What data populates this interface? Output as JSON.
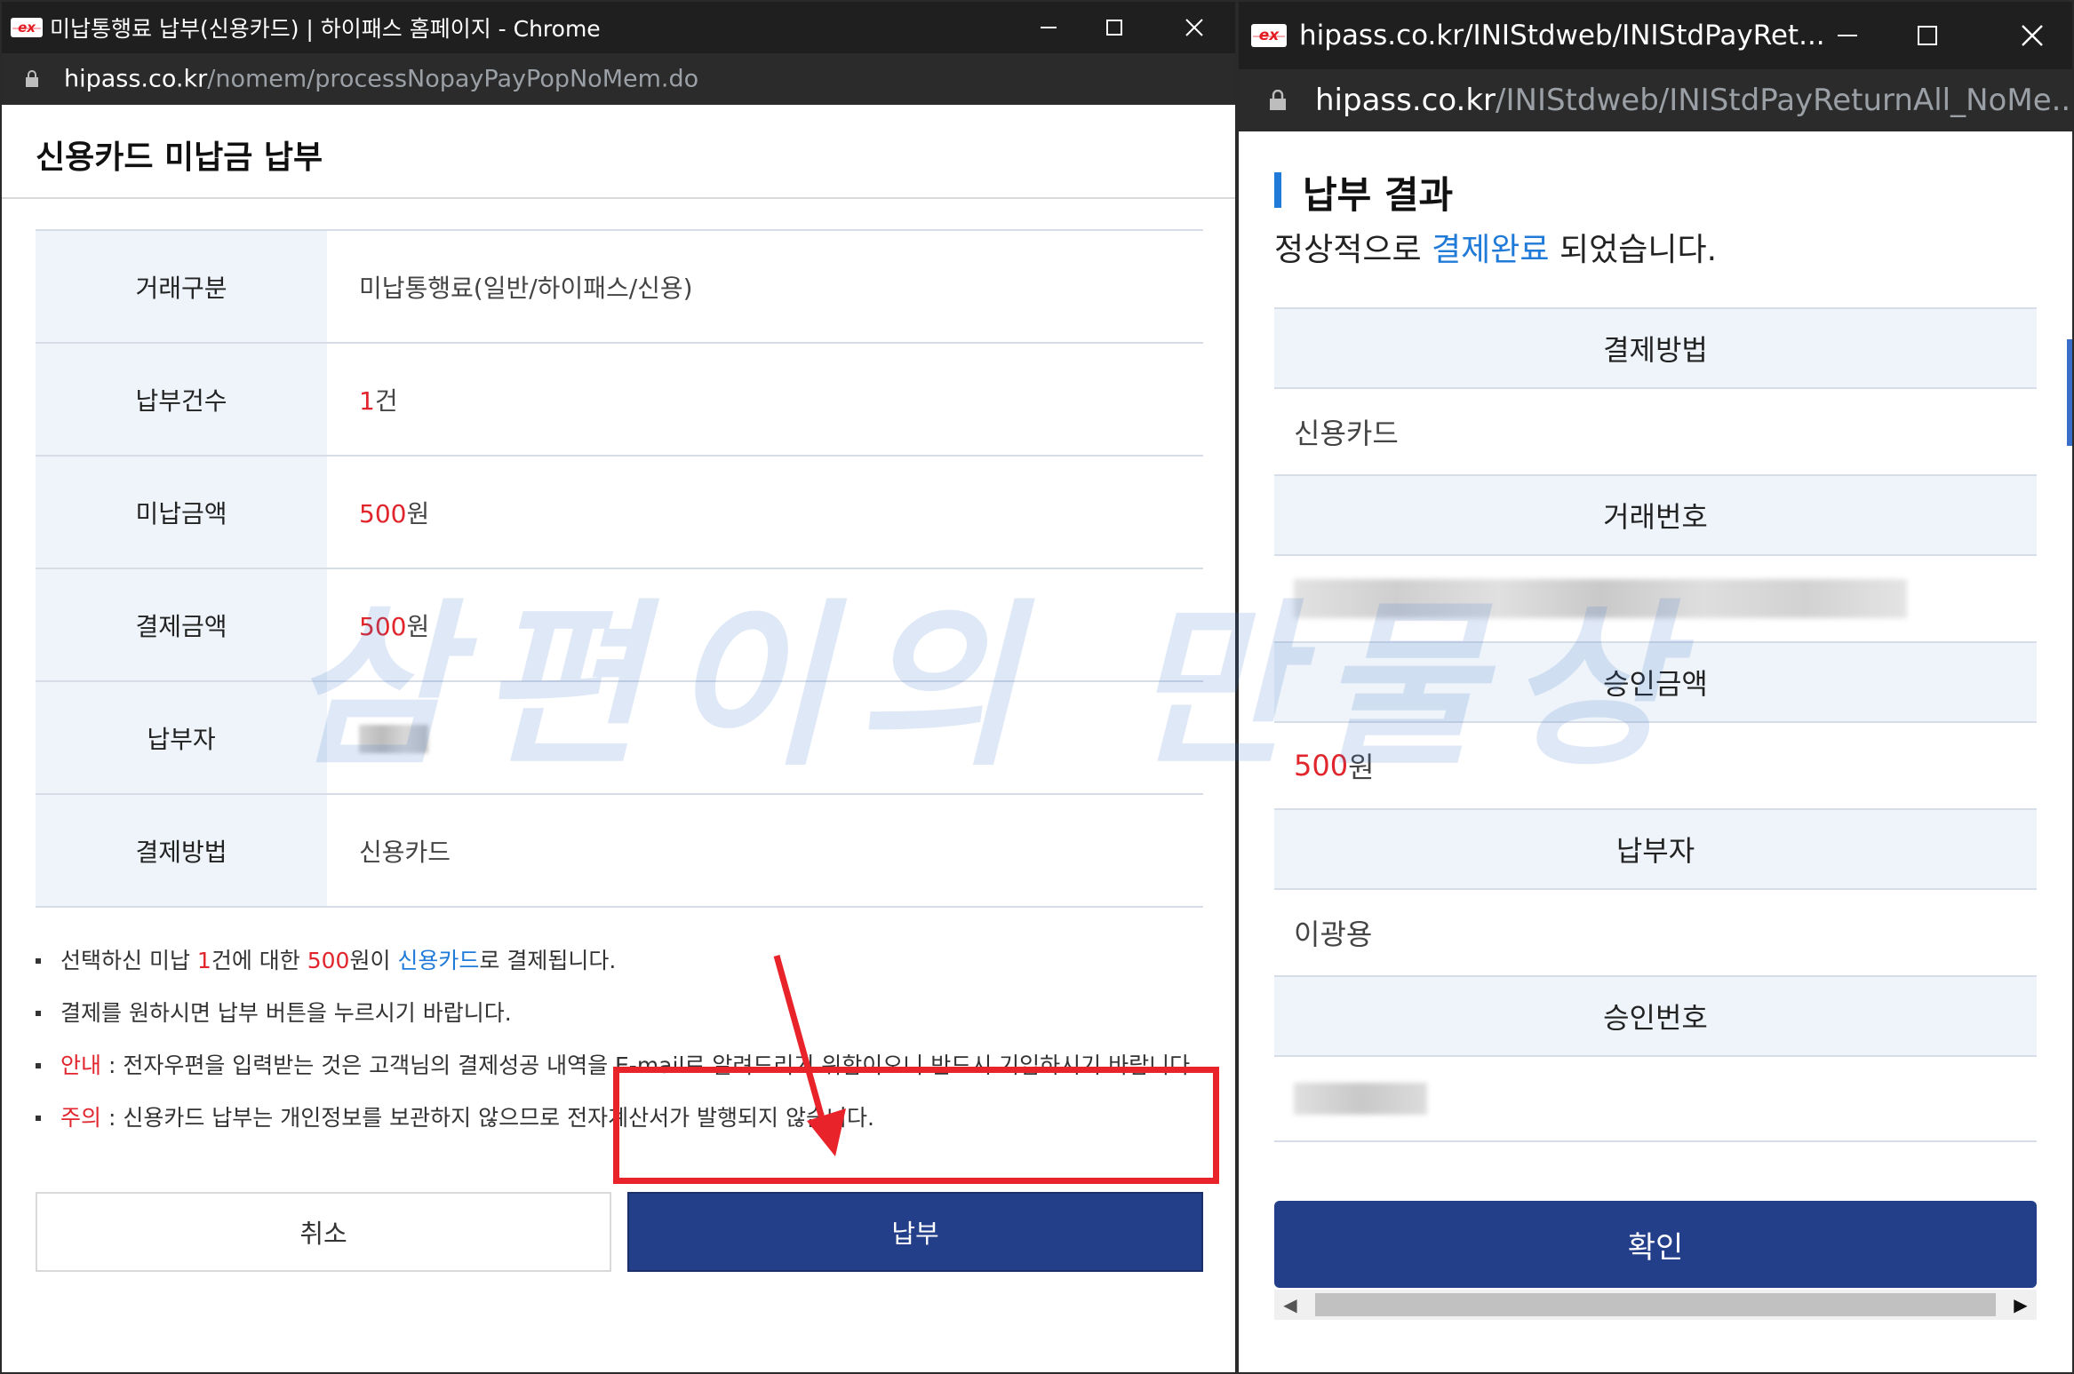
{
  "left_window": {
    "title": "미납통행료 납부(신용카드) | 하이패스 홈페이지 - Chrome",
    "logo_text": "ex",
    "url_host": "hipass.co.kr",
    "url_path": "/nomem/processNopayPayPopNoMem.do",
    "page_title": "신용카드 미납금 납부",
    "rows": [
      {
        "label": "거래구분",
        "value": "미납통행료(일반/하이패스/신용)"
      },
      {
        "label": "납부건수",
        "value_num": "1",
        "value_unit": "건"
      },
      {
        "label": "미납금액",
        "value_num": "500",
        "value_unit": "원"
      },
      {
        "label": "결제금액",
        "value_num": "500",
        "value_unit": "원"
      },
      {
        "label": "납부자"
      },
      {
        "label": "결제방법",
        "value": "신용카드"
      }
    ],
    "notes": {
      "n1_a": "선택하신 미납 ",
      "n1_b": "1",
      "n1_c": "건에 대한 ",
      "n1_d": "500",
      "n1_e": "원이 ",
      "n1_f": "신용카드",
      "n1_g": "로 결제됩니다.",
      "n2": "결제를 원하시면 납부 버튼을 누르시기 바랍니다.",
      "n3_label": "안내",
      "n3_text": " : 전자우편을 입력받는 것은 고객님의 결제성공 내역을 E-mail로 알려드리기 위함이오니 반드시 기입하시기 바랍니다.",
      "n4_label": "주의",
      "n4_text": " : 신용카드 납부는 개인정보를 보관하지 않으므로 전자계산서가 발행되지 않습니다."
    },
    "cancel_label": "취소",
    "pay_label": "납부"
  },
  "right_window": {
    "title": "hipass.co.kr/INIStdweb/INIStdPayRet...",
    "logo_text": "ex",
    "url_host": "hipass.co.kr",
    "url_path": "/INIStdweb/INIStdPayReturnAll_NoMe...",
    "result_title": "납부 결과",
    "msg_a": "정상적으로 ",
    "msg_b": "결제완료",
    "msg_c": " 되었습니다.",
    "fields": {
      "method_label": "결제방법",
      "method_value": "신용카드",
      "txn_label": "거래번호",
      "amount_label": "승인금액",
      "amount_num": "500",
      "amount_unit": "원",
      "payer_label": "납부자",
      "payer_value": "이광용",
      "approval_label": "승인번호"
    },
    "confirm_label": "확인"
  },
  "watermark": "삼편이의 만물상",
  "colors": {
    "accent_blue": "#1f7ad8",
    "button_navy": "#243f8a",
    "red": "#e1252d",
    "highlight": "#e8232a",
    "header_bg": "#eef4fa"
  }
}
